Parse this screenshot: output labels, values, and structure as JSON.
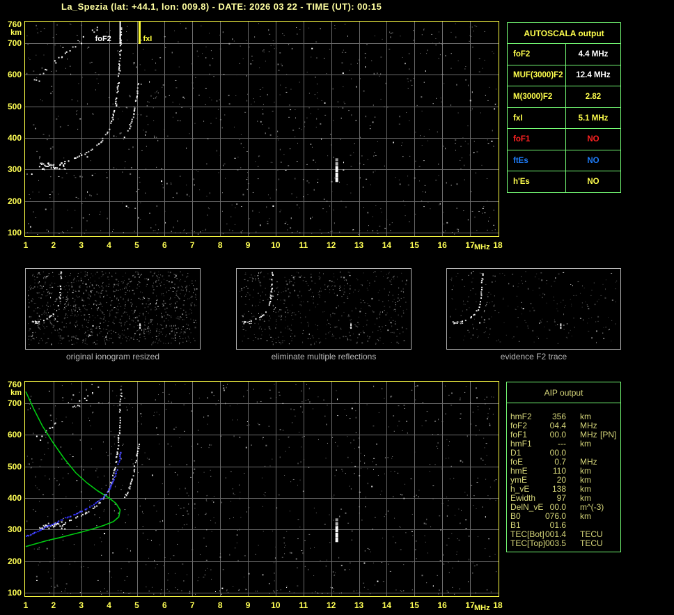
{
  "title": "La_Spezia (lat: +44.1, lon: 009.8) - DATE: 2026 03 22 - TIME (UT): 00:15",
  "axes": {
    "km_label": "km",
    "mhz_label": "MHz"
  },
  "colors": {
    "title_yellow": "#FFFFA0",
    "label_yellow": "#FFFF55",
    "plot_border_yellow": "#FFFF44",
    "grid_gray": "#6B6B6B",
    "table_border_green": "#74FB74",
    "table_yellow": "#FFFF4D",
    "value_white": "#FFFFFF",
    "alert_red": "#FF2222",
    "info_blue": "#1E7CF8",
    "aip_text": "#D6D67A",
    "caption_gray": "#B9B9B9",
    "profile_green": "#00CC11",
    "trace_blue": "#2A2AEE"
  },
  "autoscala_table": {
    "title": "AUTOSCALA output",
    "rows": [
      {
        "label": "foF2",
        "value": "4.4 MHz",
        "label_color": "#FFFF4D",
        "value_color": "#FFFFFF"
      },
      {
        "label": "MUF(3000)F2",
        "value": "12.4 MHz",
        "label_color": "#FFFF4D",
        "value_color": "#FFFFFF"
      },
      {
        "label": "M(3000)F2",
        "value": "2.82",
        "label_color": "#FFFF4D",
        "value_color": "#FFFF4D"
      },
      {
        "label": "fxI",
        "value": "5.1 MHz",
        "label_color": "#FFFF4D",
        "value_color": "#FFFF4D"
      },
      {
        "label": "foF1",
        "value": "NO",
        "label_color": "#FF2222",
        "value_color": "#FF2222"
      },
      {
        "label": "ftEs",
        "value": "NO",
        "label_color": "#1E7CF8",
        "value_color": "#1E7CF8"
      },
      {
        "label": "h'Es",
        "value": "NO",
        "label_color": "#FFFF4D",
        "value_color": "#FFFF4D"
      }
    ]
  },
  "aip_table": {
    "title": "AIP output",
    "rows": [
      {
        "label": "hmF2",
        "value": "356",
        "unit": "km",
        "extra": ""
      },
      {
        "label": "foF2",
        "value": "04.4",
        "unit": "MHz",
        "extra": ""
      },
      {
        "label": "foF1",
        "value": "00.0",
        "unit": "MHz",
        "extra": "[PN]"
      },
      {
        "label": "hmF1",
        "value": "---",
        "unit": "km",
        "extra": ""
      },
      {
        "label": "D1",
        "value": "00.0",
        "unit": "",
        "extra": ""
      },
      {
        "label": "foE",
        "value": "0.7",
        "unit": "MHz",
        "extra": ""
      },
      {
        "label": "hmE",
        "value": "110",
        "unit": "km",
        "extra": ""
      },
      {
        "label": "ymE",
        "value": "20",
        "unit": "km",
        "extra": ""
      },
      {
        "label": "h_vE",
        "value": "138",
        "unit": "km",
        "extra": ""
      },
      {
        "label": "Ewidth",
        "value": "97",
        "unit": "km",
        "extra": ""
      },
      {
        "label": "DelN_vE",
        "value": "00.0",
        "unit": "m^(-3)",
        "extra": ""
      },
      {
        "label": "B0",
        "value": "076.0",
        "unit": "km",
        "extra": ""
      },
      {
        "label": "B1",
        "value": "01.6",
        "unit": "",
        "extra": ""
      },
      {
        "label": "TEC[Bot]",
        "value": "001.4",
        "unit": "TECU",
        "extra": ""
      },
      {
        "label": "TEC[Top]",
        "value": "003.5",
        "unit": "TECU",
        "extra": ""
      }
    ]
  },
  "thumbnails": [
    {
      "caption": "original ionogram resized"
    },
    {
      "caption": "eliminate multiple reflections"
    },
    {
      "caption": "evidence F2 trace"
    }
  ],
  "chart_data": [
    {
      "name": "main-ionogram",
      "type": "scatter",
      "title": "",
      "xlabel": "MHz",
      "ylabel": "km",
      "xlim": [
        1,
        18
      ],
      "ylim": [
        100,
        760
      ],
      "x_ticks": [
        1,
        2,
        3,
        4,
        5,
        6,
        7,
        8,
        9,
        10,
        11,
        12,
        13,
        14,
        15,
        16,
        17,
        18
      ],
      "y_ticks": [
        760,
        700,
        600,
        500,
        400,
        300,
        200,
        100
      ],
      "grid": true,
      "markers": [
        {
          "label": "foF2",
          "freq": 4.4,
          "color": "#FFFFFF",
          "label_side": "left"
        },
        {
          "label": "fxI",
          "freq": 5.1,
          "color": "#FFFF40",
          "label_side": "right"
        }
      ],
      "traces": {
        "f2_ordinary": [
          [
            1.7,
            312
          ],
          [
            2.0,
            318
          ],
          [
            2.4,
            326
          ],
          [
            2.8,
            340
          ],
          [
            3.1,
            352
          ],
          [
            3.4,
            368
          ],
          [
            3.7,
            392
          ],
          [
            3.95,
            425
          ],
          [
            4.1,
            460
          ],
          [
            4.22,
            505
          ],
          [
            4.3,
            560
          ],
          [
            4.35,
            620
          ],
          [
            4.38,
            680
          ],
          [
            4.42,
            755
          ]
        ],
        "f2_extraordinary": [
          [
            4.55,
            405
          ],
          [
            4.7,
            430
          ],
          [
            4.82,
            462
          ],
          [
            4.92,
            505
          ],
          [
            5.0,
            545
          ],
          [
            5.06,
            578
          ]
        ],
        "second_hop": [
          [
            1.35,
            585
          ],
          [
            1.7,
            615
          ],
          [
            2.1,
            648
          ],
          [
            2.5,
            678
          ],
          [
            2.9,
            702
          ],
          [
            3.3,
            728
          ],
          [
            3.65,
            752
          ]
        ],
        "interference_column": {
          "freq": 12.2,
          "km_range": [
            258,
            335
          ]
        }
      }
    },
    {
      "name": "profile-ionogram",
      "type": "scatter+line",
      "xlabel": "MHz",
      "ylabel": "km",
      "xlim": [
        1,
        18
      ],
      "ylim": [
        100,
        760
      ],
      "x_ticks": [
        1,
        2,
        3,
        4,
        5,
        6,
        7,
        8,
        9,
        10,
        11,
        12,
        13,
        14,
        15,
        16,
        17,
        18
      ],
      "y_ticks": [
        760,
        700,
        600,
        500,
        400,
        300,
        200,
        100
      ],
      "grid": true,
      "shares_scatter_of": "main-ionogram",
      "overlays": {
        "density_profile_green": [
          [
            1.0,
            737
          ],
          [
            1.3,
            680
          ],
          [
            1.6,
            628
          ],
          [
            2.0,
            573
          ],
          [
            2.4,
            523
          ],
          [
            2.8,
            480
          ],
          [
            3.2,
            448
          ],
          [
            3.6,
            422
          ],
          [
            4.0,
            400
          ],
          [
            4.25,
            383
          ],
          [
            4.4,
            362
          ],
          [
            4.35,
            340
          ],
          [
            4.15,
            325
          ],
          [
            3.8,
            313
          ],
          [
            3.4,
            302
          ],
          [
            3.0,
            292
          ],
          [
            2.6,
            283
          ],
          [
            2.2,
            274
          ],
          [
            1.8,
            266
          ],
          [
            1.4,
            256
          ],
          [
            1.0,
            246
          ]
        ],
        "fitted_trace_blue": [
          [
            1.0,
            280
          ],
          [
            1.3,
            292
          ],
          [
            1.6,
            305
          ],
          [
            1.9,
            318
          ],
          [
            2.2,
            330
          ],
          [
            2.5,
            342
          ],
          [
            2.8,
            352
          ],
          [
            3.1,
            365
          ],
          [
            3.4,
            380
          ],
          [
            3.7,
            398
          ],
          [
            3.9,
            418
          ],
          [
            4.05,
            440
          ],
          [
            4.18,
            468
          ],
          [
            4.28,
            495
          ],
          [
            4.35,
            522
          ],
          [
            4.41,
            552
          ]
        ]
      }
    }
  ]
}
